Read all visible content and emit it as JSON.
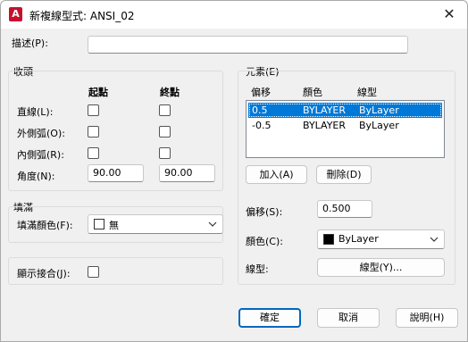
{
  "window": {
    "app_icon_letter": "A",
    "title": "新複線型式: ANSI_02",
    "close_glyph": "✕"
  },
  "description": {
    "label": "描述(P):",
    "value": ""
  },
  "caps": {
    "title": "收頭",
    "col_start": "起點",
    "col_end": "終點",
    "rows": [
      {
        "label": "直線(L):",
        "start_checked": false,
        "end_checked": false
      },
      {
        "label": "外側弧(O):",
        "start_checked": false,
        "end_checked": false
      },
      {
        "label": "內側弧(R):",
        "start_checked": false,
        "end_checked": false
      }
    ],
    "angle_label": "角度(N):",
    "angle_start": "90.00",
    "angle_end": "90.00"
  },
  "fill": {
    "title": "填滿",
    "color_label": "填滿顏色(F):",
    "color_value": "無",
    "swatch_color": "#ffffff"
  },
  "joints": {
    "label": "顯示接合(J):",
    "checked": false
  },
  "elements": {
    "title": "元素(E)",
    "headers": [
      "偏移",
      "顏色",
      "線型"
    ],
    "rows": [
      {
        "offset": "0.5",
        "color": "BYLAYER",
        "linetype": "ByLayer",
        "selected": true
      },
      {
        "offset": "-0.5",
        "color": "BYLAYER",
        "linetype": "ByLayer",
        "selected": false
      }
    ],
    "add_label": "加入(A)",
    "delete_label": "刪除(D)",
    "offset_label": "偏移(S):",
    "offset_value": "0.500",
    "color_label": "顏色(C):",
    "color_value": "ByLayer",
    "color_swatch": "#000000",
    "linetype_label": "線型:",
    "linetype_button": "線型(Y)..."
  },
  "footer": {
    "ok": "確定",
    "cancel": "取消",
    "help": "說明(H)"
  },
  "colors": {
    "accent": "#0067c0",
    "selection": "#0078d7",
    "brand": "#c8102e"
  }
}
